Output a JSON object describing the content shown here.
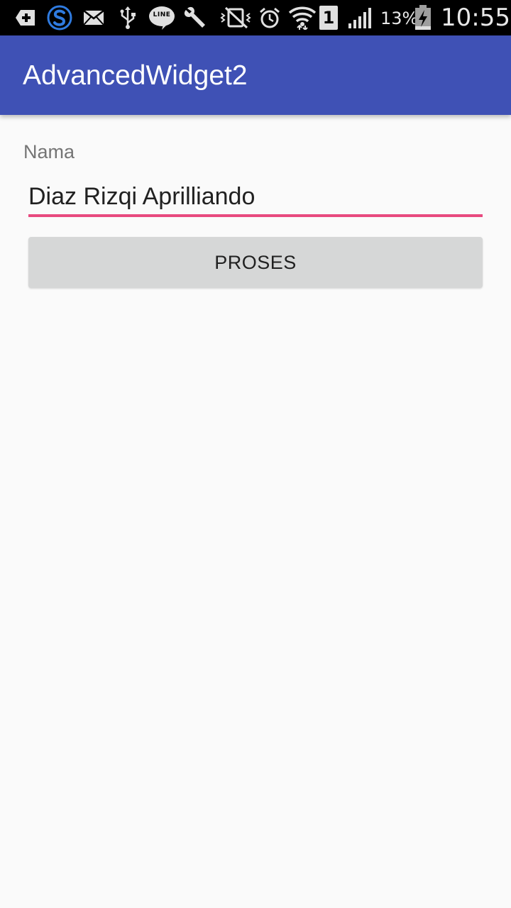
{
  "status_bar": {
    "battery_percent": "13%",
    "time": "10:55",
    "sim_slot": "1",
    "line_label": "LINE",
    "icons": [
      "add-box-icon",
      "s-app-icon",
      "mail-icon",
      "usb-icon",
      "line-app-icon",
      "wrench-icon",
      "vibrate-mute-icon",
      "alarm-icon",
      "wifi-icon",
      "sim-1-icon",
      "signal-icon",
      "battery-charging-icon"
    ]
  },
  "app_bar": {
    "title": "AdvancedWidget2",
    "color": "#3f51b5"
  },
  "form": {
    "label": "Nama",
    "input_value": "Diaz Rizqi Aprilliando",
    "input_accent_color": "#e84a7f",
    "button_label": "PROSES"
  }
}
